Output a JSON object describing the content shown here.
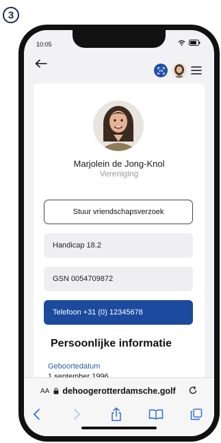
{
  "step": {
    "number": "3"
  },
  "status_bar": {
    "time": "10:05"
  },
  "profile": {
    "name": "Marjolein de Jong-Knol",
    "subtitle": "Vereniging",
    "friend_request_label": "Stuur vriendschapsverzoek"
  },
  "info": {
    "handicap": "Handicap 18.2",
    "gsn": "GSN 0054709872",
    "phone": "Telefoon +31 (0) 12345678"
  },
  "personal": {
    "title": "Persoonlijke informatie",
    "birth_label": "Geboortedatum",
    "birth_value": "1 september 1996"
  },
  "browser": {
    "text_size_label": "AA",
    "url": "dehoogerotterdamsche.golf"
  },
  "colors": {
    "accent_blue": "#1c4a9e",
    "label_blue": "#2b5aa8",
    "card_bg": "#ffffff",
    "screen_bg": "#f2f2f4"
  },
  "icons": [
    "back-arrow-icon",
    "scan-icon",
    "menu-icon",
    "wifi-icon",
    "battery-icon",
    "lock-icon",
    "reload-icon",
    "chevron-left-icon",
    "chevron-right-icon",
    "share-icon",
    "bookmarks-icon",
    "tabs-icon"
  ]
}
